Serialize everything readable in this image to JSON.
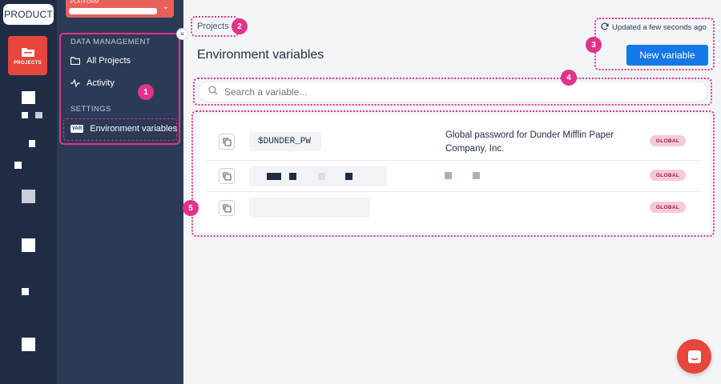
{
  "app": {
    "product_label": "PRODUCT"
  },
  "rail": {
    "projects_label": "PROJECTS"
  },
  "platform": {
    "label": "PLATFORM"
  },
  "sidebar": {
    "data_management_heading": "DATA MANAGEMENT",
    "items": [
      {
        "label": "All Projects",
        "icon": "folder-icon"
      },
      {
        "label": "Activity",
        "icon": "activity-icon"
      }
    ],
    "settings_heading": "SETTINGS",
    "settings_items": [
      {
        "label": "Environment variables",
        "icon": "var-icon",
        "icon_text": "VAR",
        "active": true
      }
    ]
  },
  "main": {
    "breadcrumb": "Projects",
    "title": "Environment variables",
    "updated_text": "Updated a few seconds ago",
    "new_button_label": "New variable",
    "search_placeholder": "Search a variable..."
  },
  "variables": [
    {
      "name": "$DUNDER_PW",
      "description": "Global password for Dunder Mifflin Paper Company, Inc.",
      "scope": "GLOBAL"
    },
    {
      "name": "",
      "description": "",
      "scope": "GLOBAL"
    },
    {
      "name": "",
      "description": "",
      "scope": "GLOBAL"
    }
  ],
  "markers": [
    "1",
    "2",
    "3",
    "4",
    "5"
  ],
  "colors": {
    "accent_pink": "#e0338a",
    "primary_blue": "#1378e8",
    "brand_red": "#e8453c",
    "sidebar": "#2b3a55",
    "rail": "#1f2c44"
  }
}
